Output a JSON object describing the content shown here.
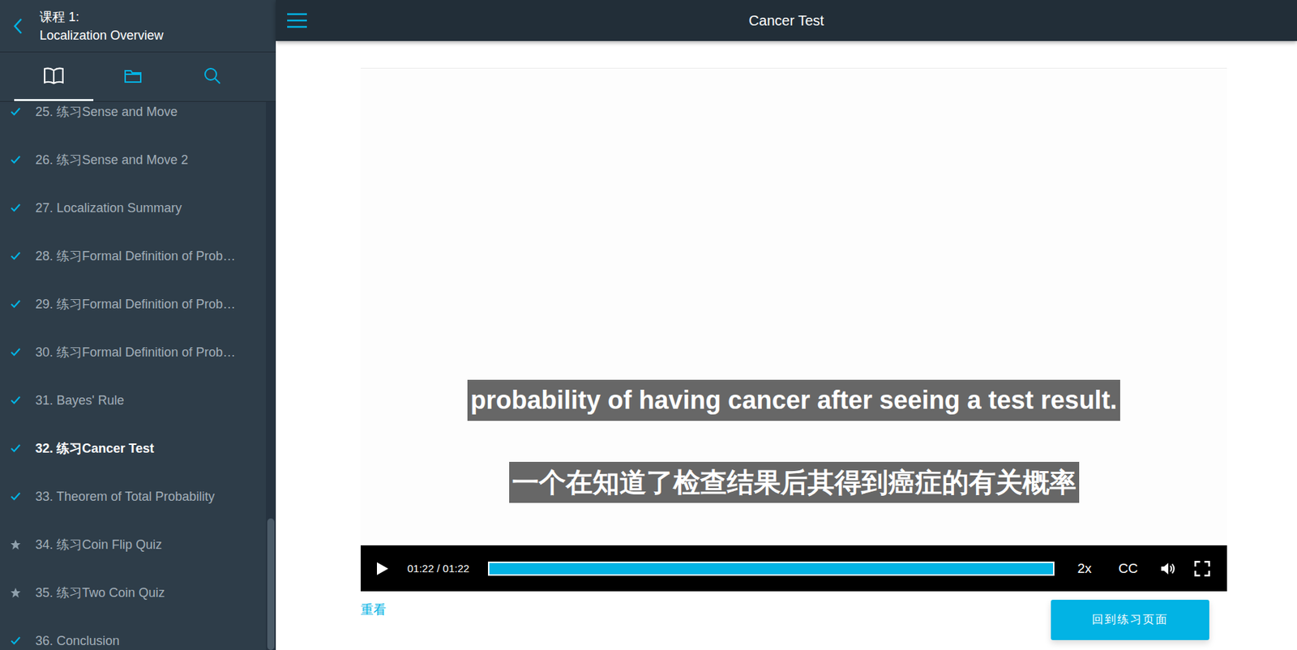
{
  "course": {
    "label": "课程 1:",
    "title": "Localization Overview"
  },
  "sidebar_tabs": [
    {
      "kind": "book",
      "selected": true
    },
    {
      "kind": "folder",
      "selected": false
    },
    {
      "kind": "search",
      "selected": false
    }
  ],
  "lessons": [
    {
      "label": "25. 练习Sense and Move",
      "kind": "check",
      "selected": false
    },
    {
      "label": "26. 练习Sense and Move 2",
      "kind": "check",
      "selected": false
    },
    {
      "label": "27. Localization Summary",
      "kind": "check",
      "selected": false
    },
    {
      "label": "28. 练习Formal Definition of Prob…",
      "kind": "check",
      "selected": false
    },
    {
      "label": "29. 练习Formal Definition of Prob…",
      "kind": "check",
      "selected": false
    },
    {
      "label": "30. 练习Formal Definition of Prob…",
      "kind": "check",
      "selected": false
    },
    {
      "label": "31. Bayes' Rule",
      "kind": "check",
      "selected": false
    },
    {
      "label": "32. 练习Cancer Test",
      "kind": "check",
      "selected": true
    },
    {
      "label": "33. Theorem of Total Probability",
      "kind": "check",
      "selected": false
    },
    {
      "label": "34. 练习Coin Flip Quiz",
      "kind": "star",
      "selected": false
    },
    {
      "label": "35. 练习Two Coin Quiz",
      "kind": "star",
      "selected": false
    },
    {
      "label": "36. Conclusion",
      "kind": "check",
      "selected": false
    }
  ],
  "sidebar_scroll": {
    "level": 0.76
  },
  "page": {
    "title": "Cancer Test"
  },
  "video": {
    "subtitle_en": "probability of having cancer after seeing a test result.",
    "subtitle_zh": "一个在知道了检查结果后其得到癌症的有关概率",
    "time": "01:22 / 01:22",
    "level": 1,
    "speed": "2x",
    "captions": "CC",
    "playing": false
  },
  "actions": {
    "replay": "重看",
    "back": "回到练习页面"
  }
}
